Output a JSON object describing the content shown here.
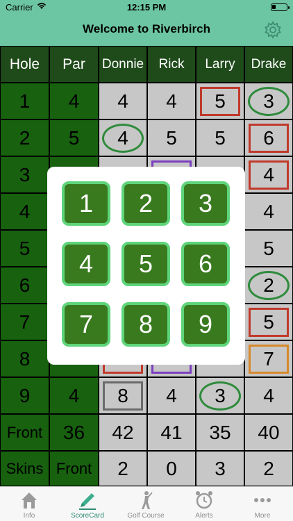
{
  "status": {
    "carrier": "Carrier",
    "time": "12:15 PM"
  },
  "nav": {
    "title": "Welcome to Riverbirch"
  },
  "grid": {
    "headers": [
      "Hole",
      "Par",
      "Donnie",
      "Rick",
      "Larry",
      "Drake"
    ],
    "rows": [
      {
        "hole": "1",
        "par": "4",
        "scores": [
          "4",
          "4",
          "5",
          "3"
        ]
      },
      {
        "hole": "2",
        "par": "5",
        "scores": [
          "4",
          "5",
          "5",
          "6"
        ]
      },
      {
        "hole": "3",
        "par": "",
        "scores": [
          "",
          "",
          "",
          "4"
        ]
      },
      {
        "hole": "4",
        "par": "",
        "scores": [
          "",
          "",
          "",
          "4"
        ]
      },
      {
        "hole": "5",
        "par": "",
        "scores": [
          "",
          "",
          "",
          "5"
        ]
      },
      {
        "hole": "6",
        "par": "",
        "scores": [
          "",
          "",
          "",
          "2"
        ]
      },
      {
        "hole": "7",
        "par": "",
        "scores": [
          "",
          "",
          "",
          "5"
        ]
      },
      {
        "hole": "8",
        "par": "",
        "scores": [
          "",
          "",
          "",
          "7"
        ]
      },
      {
        "hole": "9",
        "par": "4",
        "scores": [
          "8",
          "4",
          "3",
          "4"
        ]
      }
    ],
    "front": {
      "label": "Front",
      "par": "36",
      "scores": [
        "42",
        "41",
        "35",
        "40"
      ]
    },
    "skins": {
      "label": "Skins",
      "par": "Front",
      "scores": [
        "2",
        "0",
        "3",
        "2"
      ]
    }
  },
  "picker": {
    "keys": [
      "1",
      "2",
      "3",
      "4",
      "5",
      "6",
      "7",
      "8",
      "9"
    ]
  },
  "tabs": [
    {
      "label": "Info"
    },
    {
      "label": "ScoreCard"
    },
    {
      "label": "Golf Course"
    },
    {
      "label": "Alerts"
    },
    {
      "label": "More"
    }
  ],
  "colors": {
    "nav": "#6dc6a3",
    "header": "#1f4a1a",
    "hole": "#17610f",
    "score_bg": "#c7c7c7",
    "key_bg": "#3a7a1f",
    "key_border": "#5ed47b",
    "bogey": "#c0392b",
    "birdie": "#2e8b3c",
    "active_tab": "#2d8b73"
  }
}
